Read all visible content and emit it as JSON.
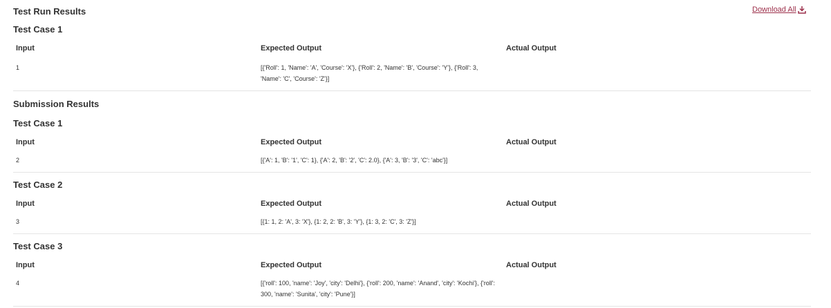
{
  "download_label": "Download All",
  "column_headers": {
    "input": "Input",
    "expected": "Expected Output",
    "actual": "Actual Output"
  },
  "test_run": {
    "title": "Test Run Results",
    "cases": [
      {
        "title": "Test Case 1",
        "input": "1",
        "expected": "[{'Roll': 1, 'Name': 'A', 'Course': 'X'}, {'Roll': 2, 'Name': 'B', 'Course': 'Y'}, {'Roll': 3, 'Name': 'C', 'Course': 'Z'}]",
        "actual": ""
      }
    ]
  },
  "submission": {
    "title": "Submission Results",
    "cases": [
      {
        "title": "Test Case 1",
        "input": "2",
        "expected": "[{'A': 1, 'B': '1', 'C': 1}, {'A': 2, 'B': '2', 'C': 2.0}, {'A': 3, 'B': '3', 'C': 'abc'}]",
        "actual": ""
      },
      {
        "title": "Test Case 2",
        "input": "3",
        "expected": "[{1: 1, 2: 'A', 3: 'X'}, {1: 2, 2: 'B', 3: 'Y'}, {1: 3, 2: 'C', 3: 'Z'}]",
        "actual": ""
      },
      {
        "title": "Test Case 3",
        "input": "4",
        "expected": "[{'roll': 100, 'name': 'Joy', 'city': 'Delhi'}, {'roll': 200, 'name': 'Anand', 'city': 'Kochi'}, {'roll': 300, 'name': 'Sunita', 'city': 'Pune'}]",
        "actual": ""
      }
    ]
  },
  "icons": {
    "download": "download-icon"
  },
  "colors": {
    "link": "#9c2f4a",
    "divider": "#e4e4e4",
    "text": "#333333"
  }
}
